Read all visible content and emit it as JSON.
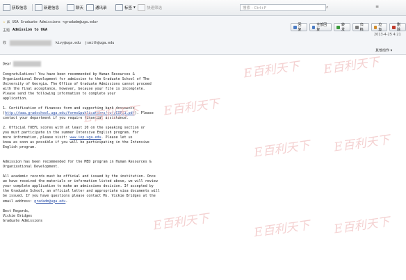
{
  "toolbar": {
    "buttons": [
      {
        "label": "获取信息"
      },
      {
        "label": "新建信息"
      },
      {
        "label": "聊天"
      },
      {
        "label": "通讯录"
      },
      {
        "label": "标签"
      },
      {
        "label": "快速筛选"
      }
    ],
    "search_placeholder": "搜索 - Ctrl+F"
  },
  "message": {
    "from_prefix": "从",
    "sender": "UGA Graduate Admissions <gradadm@uga.edu>",
    "subject_label": "主题",
    "subject": "Admission to UGA",
    "to_label": "收",
    "to_1": "kivy@uga.edu",
    "to_2": "jsmith@uga.edu",
    "date": "2013-4-25 4:21",
    "more_actions": "其他动作"
  },
  "actions": [
    {
      "label": "回复",
      "color": "#4a7bc4"
    },
    {
      "label": "全部回复",
      "color": "#4a7bc4"
    },
    {
      "label": "转发",
      "color": "#3b9a3b"
    },
    {
      "label": "归档",
      "color": "#7a7a7a"
    },
    {
      "label": "垃圾",
      "color": "#d08a2b"
    },
    {
      "label": "删除",
      "color": "#c0392b"
    }
  ],
  "body": {
    "greeting": "Dear",
    "p1": "Congratulations! You have been recommended by Human Resources &\nOrganizational Development for admission to the Graduate School of The\nUniversity of Georgia. The Office of Graduate Admissions cannot proceed\nwith the final acceptance, however, because your file is incomplete.\nPlease send the following information to complete your\napplication.",
    "p2a": "1. Certification of finances form and supporting bank documents\n(",
    "p2_link": "http://www.gradschool.uga.edu/forms&publications/cof/COF13.pdf",
    "p2b": "). Please\ncontact your department if you require financial assistance.",
    "p3a": "2. Official TOEFL scores with at least 20 on the speaking section or\nyou must participate in the summer Intensive English program.  For\nmore information, please visit: ",
    "p3_link": "www.iep.uga.edu",
    "p3b": ".  Please let us\nknow as soon as possible if you will be participating in the Intensive\nEnglish program.",
    "p4": "Admission has been recommended for the MED program in Human Resources &\nOrganizational Development.",
    "p5a": "All academic records must be official and issued by the institution.  Once\nwe have received the materials or information listed above, we will review\nyour complete application to make an admissions decision. If accepted by\nthe Graduate School, an official letter and appropriate visa documents will\nbe issued. If you have questions please contact Ms. Vickie Bridges at the\nemail address: ",
    "p5_link": "gradadm@uga.edu",
    "p5b": ".",
    "sign1": "Best Regards,",
    "sign2": "Vickie Bridges",
    "sign3": "Graduate Admissions"
  },
  "watermark": "E百利天下"
}
